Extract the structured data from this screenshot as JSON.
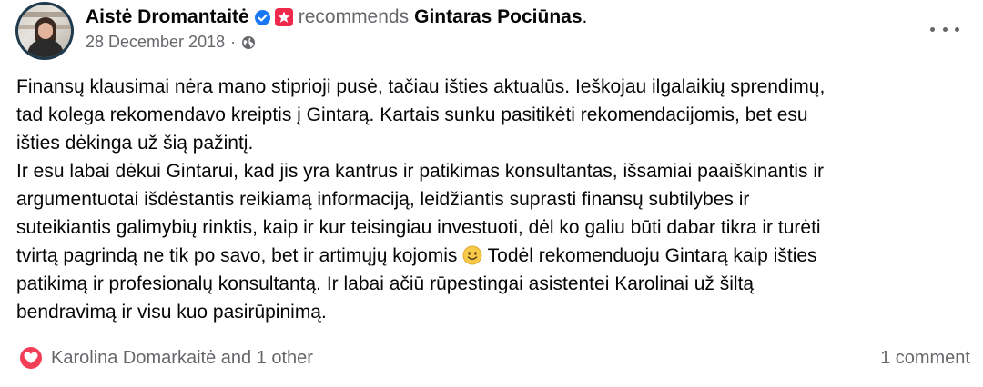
{
  "post": {
    "author": "Aistė Dromantaitė",
    "recommends_text": "recommends",
    "target": "Gintaras Pociūnas",
    "period": ".",
    "date": "28 December 2018",
    "separator": "·",
    "text_part1": "Finansų klausimai nėra mano stiprioji pusė, tačiau išties aktualūs. Ieškojau ilgalaikių sprendimų,\ntad kolega rekomendavo kreiptis į Gintarą. Kartais sunku pasitikėti rekomendacijomis, bet esu\ništies dėkinga už šią pažintį.\nIr esu labai dėkui Gintarui, kad jis yra kantrus ir patikimas konsultantas, išsamiai paaiškinantis ir\nargumentuotai išdėstantis reikiamą informaciją, leidžiantis suprasti finansų subtilybes ir\nsuteikiantis galimybių rinktis, kaip ir kur teisingiau investuoti, dėl ko galiu būti dabar tikra ir turėti\ntvirtą pagrindą ne tik po savo, bet ir artimųjų kojomis ",
    "text_part2": " Todėl rekomenduoju Gintarą kaip išties\npatikimą ir profesionalų konsultantą. Ir labai ačiū rūpestingai asistentei Karolinai už šiltą\nbendravimą ir visu kuo pasirūpinimą.",
    "reactions_text": "Karolina Domarkaitė and 1 other",
    "comments_text": "1 comment"
  },
  "icons": {
    "verified": "verified-badge-icon",
    "recommendation": "star-recommendation-icon",
    "privacy": "globe-icon",
    "more": "more-options-icon",
    "emoji": "smiling-face-emoji",
    "reaction": "love-reaction-icon"
  },
  "colors": {
    "verified": "#1877f2",
    "recommend_badge": "#f02849",
    "secondary_text": "#65676b",
    "love": "#f33e58"
  }
}
